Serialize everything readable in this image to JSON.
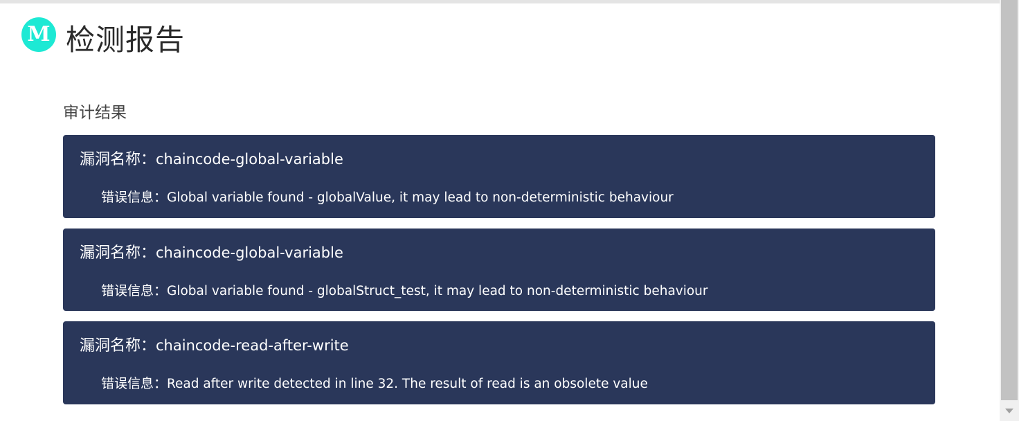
{
  "header": {
    "logo_letter": "M",
    "title": "检测报告"
  },
  "section": {
    "title": "审计结果"
  },
  "results": [
    {
      "vuln_label": "漏洞名称：",
      "vuln_name": "chaincode-global-variable",
      "error_label": "错误信息：",
      "error_message": "Global variable found - globalValue, it may lead to non-deterministic behaviour"
    },
    {
      "vuln_label": "漏洞名称：",
      "vuln_name": "chaincode-global-variable",
      "error_label": "错误信息：",
      "error_message": "Global variable found - globalStruct_test, it may lead to non-deterministic behaviour"
    },
    {
      "vuln_label": "漏洞名称：",
      "vuln_name": "chaincode-read-after-write",
      "error_label": "错误信息：",
      "error_message": "Read after write detected in line 32. The result of read is an obsolete value"
    }
  ],
  "colors": {
    "logo": "#1de9d4",
    "card_background": "#2a375a",
    "card_text": "#ffffff"
  },
  "scrollbar": {
    "arrow_icon": "chevron-down-icon"
  }
}
